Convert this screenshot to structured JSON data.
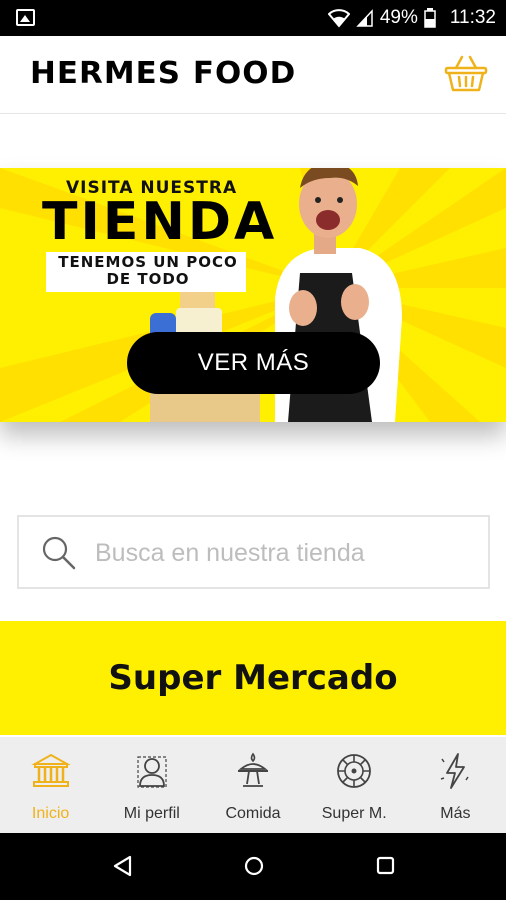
{
  "status_bar": {
    "battery_percent": "49%",
    "time": "11:32",
    "icons": [
      "image-icon",
      "wifi-icon",
      "signal-icon",
      "battery-icon"
    ]
  },
  "header": {
    "logo_text": "HERMES FOOD",
    "cart_icon": "shopping-basket-icon",
    "accent_color": "#f0b21a"
  },
  "banner": {
    "line1": "VISITA NUESTRA",
    "line2": "TIENDA",
    "line3a": "TENEMOS UN POCO",
    "line3b": "DE TODO",
    "button_label": "VER MÁS",
    "background_color": "#ffef00"
  },
  "search": {
    "placeholder": "Busca en nuestra tienda",
    "icon": "search-icon"
  },
  "category": {
    "title": "Super Mercado",
    "background_color": "#ffef00"
  },
  "bottom_nav": {
    "items": [
      {
        "label": "Inicio",
        "icon": "bank-icon",
        "active": true
      },
      {
        "label": "Mi perfil",
        "icon": "profile-icon",
        "active": false
      },
      {
        "label": "Comida",
        "icon": "food-icon",
        "active": false
      },
      {
        "label": "Super M.",
        "icon": "market-icon",
        "active": false
      },
      {
        "label": "Más",
        "icon": "lightning-icon",
        "active": false
      }
    ]
  },
  "system_nav": {
    "icons": [
      "back-icon",
      "home-icon",
      "recents-icon"
    ]
  }
}
